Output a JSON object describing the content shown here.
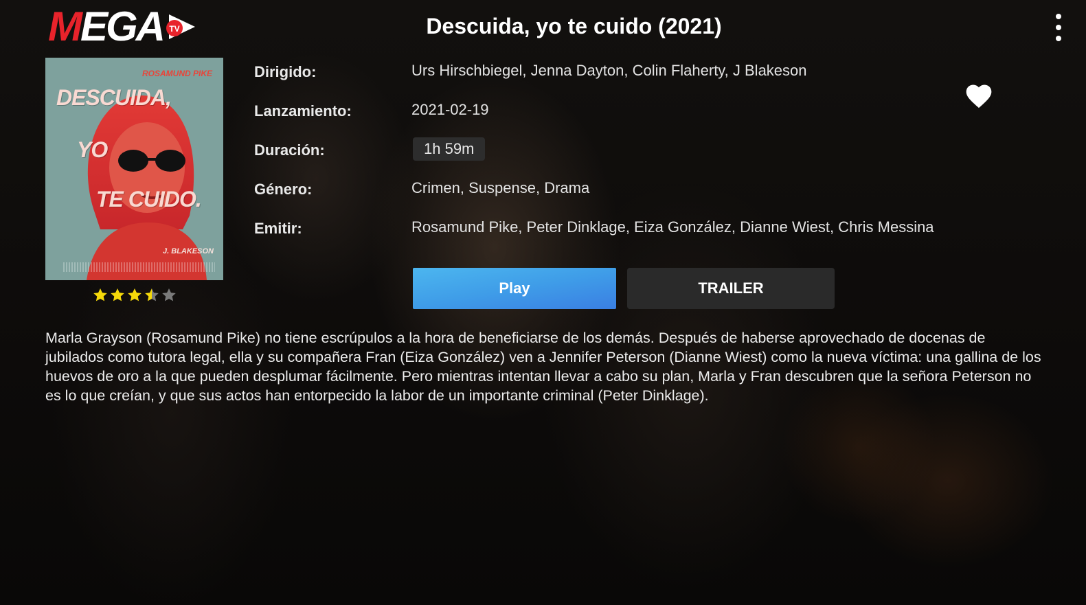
{
  "app": {
    "logo_text_m": "M",
    "logo_text_rest": "EGA",
    "logo_badge": "TV",
    "menu_icon": "more-vertical-icon"
  },
  "movie": {
    "title": "Descuida, yo te cuido (2021)",
    "poster": {
      "actor": "ROSAMUND PIKE",
      "line1": "DESCUIDA,",
      "line2": "YO",
      "line3": "TE CUIDO.",
      "director": "J. BLAKESON"
    },
    "rating": {
      "value": 3.5,
      "max": 5,
      "filled_color": "#f5d90a",
      "empty_color": "#7a7a7a"
    },
    "details": [
      {
        "label": "Dirigido:",
        "value": "Urs Hirschbiegel, Jenna Dayton, Colin Flaherty, J Blakeson"
      },
      {
        "label": "Lanzamiento:",
        "value": "2021-02-19"
      },
      {
        "label": "Duración:",
        "value": "1h 59m"
      },
      {
        "label": "Género:",
        "value": "Crimen, Suspense, Drama"
      },
      {
        "label": "Emitir:",
        "value": "Rosamund Pike, Peter Dinklage, Eiza González, Dianne Wiest, Chris Messina"
      }
    ],
    "favorite_icon": "heart-icon",
    "synopsis": "Marla Grayson (Rosamund Pike) no tiene escrúpulos a la hora de beneficiarse de los demás. Después de haberse aprovechado de docenas de jubilados como tutora legal, ella y su compañera Fran (Eiza González) ven a Jennifer Peterson (Dianne Wiest) como la nueva víctima: una gallina de los huevos de oro a la que pueden desplumar fácilmente. Pero mientras intentan llevar a cabo su plan, Marla y Fran descubren que la señora Peterson no es lo que creían, y que sus actos han entorpecido la labor de un importante criminal (Peter Dinklage)."
  },
  "actions": {
    "play_label": "Play",
    "trailer_label": "TRAILER"
  },
  "colors": {
    "brand_red": "#e8232b",
    "play_blue": "#3f9de8",
    "trailer_bg": "#2a2a2a"
  }
}
